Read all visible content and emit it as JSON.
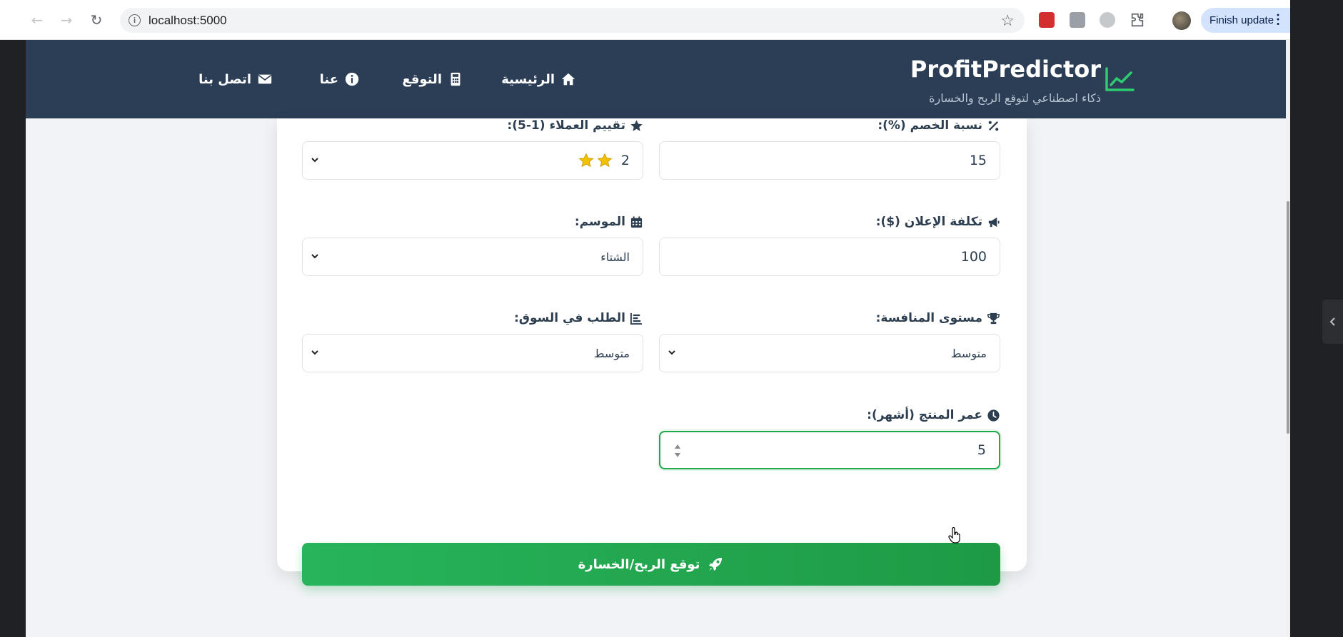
{
  "browser": {
    "back_icon": "←",
    "forward_icon": "→",
    "reload_icon": "↻",
    "url": "localhost:5000",
    "finish_update_label": "Finish update"
  },
  "app": {
    "brand_title": "ProfitPredictor",
    "brand_subtitle": "ذكاء اصطناعي لتوقع الربح والخسارة",
    "nav": [
      {
        "label": "الرئيسية",
        "icon": "home-icon"
      },
      {
        "label": "التوقع",
        "icon": "calculator-icon"
      },
      {
        "label": "عنا",
        "icon": "info-circle-icon"
      },
      {
        "label": "اتصل بنا",
        "icon": "envelope-icon"
      }
    ]
  },
  "form": {
    "discount": {
      "label": "نسبة الخصم (%):",
      "value": "15"
    },
    "rating": {
      "label": "تقييم العملاء (1-5):",
      "value": "2",
      "stars": 2
    },
    "ad_cost": {
      "label": "تكلفة الإعلان ($):",
      "value": "100"
    },
    "season": {
      "label": "الموسم:",
      "value": "الشتاء"
    },
    "competition": {
      "label": "مستوى المنافسة:",
      "value": "متوسط"
    },
    "demand": {
      "label": "الطلب في السوق:",
      "value": "متوسط"
    },
    "product_age": {
      "label": "عمر المنتج (أشهر):",
      "value": "5"
    },
    "submit_label": "توقع الربح/الخسارة"
  },
  "colors": {
    "header_bg": "#2c3e55",
    "accent_green": "#22a94d",
    "star_gold": "#f2c200"
  }
}
